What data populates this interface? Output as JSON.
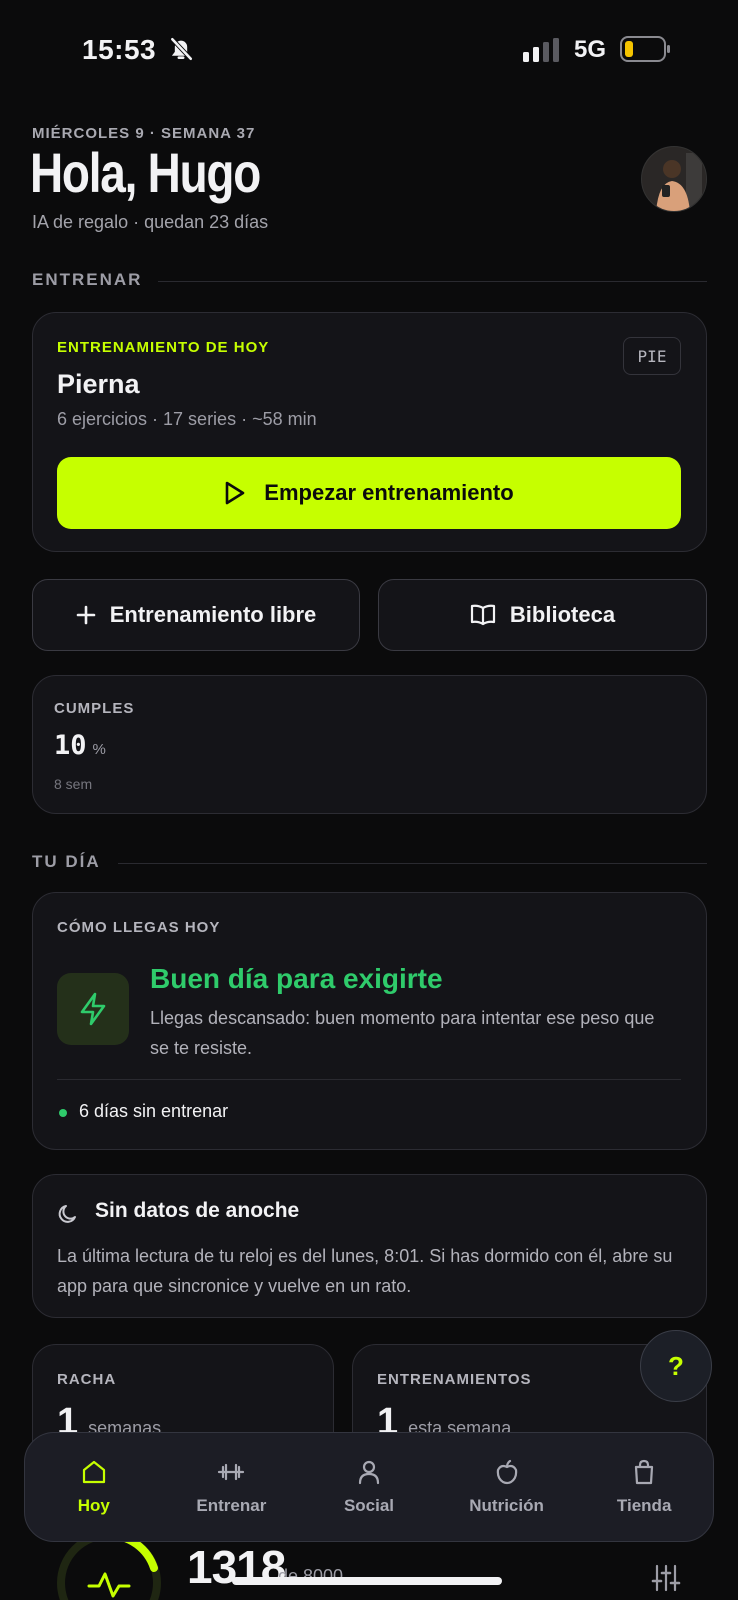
{
  "status_bar": {
    "time": "15:53",
    "network": "5G"
  },
  "header": {
    "date_line": "MIÉRCOLES 9 · SEMANA 37",
    "greeting": "Hola, Hugo",
    "subline": "IA de regalo · quedan 23 días"
  },
  "sections": {
    "train": "ENTRENAR",
    "your_day": "TU DÍA"
  },
  "today_workout": {
    "eyebrow": "ENTRENAMIENTO DE HOY",
    "badge": "PIE",
    "title": "Pierna",
    "meta": "6 ejercicios · 17 series · ~58 min",
    "start_label": "Empezar entrenamiento"
  },
  "quick_actions": {
    "free_label": "Entrenamiento libre",
    "library_label": "Biblioteca"
  },
  "compliance": {
    "label": "CUMPLES",
    "value": "10",
    "unit": "%",
    "period": "8 sem"
  },
  "readiness": {
    "label": "CÓMO LLEGAS HOY",
    "headline": "Buen día para exigirte",
    "body": "Llegas descansado: buen momento para intentar ese peso que se te resiste.",
    "footnote": "6 días sin entrenar"
  },
  "sleep": {
    "title": "Sin datos de anoche",
    "body": "La última lectura de tu reloj es del lunes, 8:01. Si has dormido con él, abre su app para que sincronice y vuelve en un rato."
  },
  "streak": {
    "label": "RACHA",
    "value": "1",
    "unit": "semanas"
  },
  "workouts": {
    "label": "ENTRENAMIENTOS",
    "value": "1",
    "unit": "esta semana"
  },
  "activity": {
    "value": "1318",
    "suffix": "de 8000"
  },
  "help": {
    "label": "?"
  },
  "tabbar": {
    "items": [
      {
        "label": "Hoy",
        "icon": "home-icon"
      },
      {
        "label": "Entrenar",
        "icon": "dumbbell-icon"
      },
      {
        "label": "Social",
        "icon": "person-icon"
      },
      {
        "label": "Nutrición",
        "icon": "apple-icon"
      },
      {
        "label": "Tienda",
        "icon": "shopping-bag-icon"
      }
    ]
  },
  "colors": {
    "accent": "#c6ff00",
    "good": "#2fcb6b",
    "bg": "#0b0b0c",
    "card": "#141418"
  }
}
